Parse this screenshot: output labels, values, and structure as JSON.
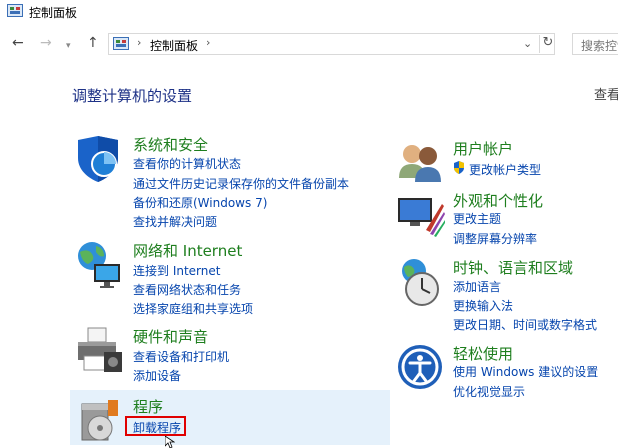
{
  "window": {
    "title": "控制面板"
  },
  "address": {
    "crumb": "控制面板",
    "search_placeholder": "搜索控制"
  },
  "main": {
    "heading": "调整计算机的设置",
    "view_by": "查看"
  },
  "categories": [
    {
      "title": "系统和安全",
      "links": [
        "查看你的计算机状态",
        "通过文件历史记录保存你的文件备份副本",
        "备份和还原(Windows 7)",
        "查找并解决问题"
      ]
    },
    {
      "title": "网络和 Internet",
      "links": [
        "连接到 Internet",
        "查看网络状态和任务",
        "选择家庭组和共享选项"
      ]
    },
    {
      "title": "硬件和声音",
      "links": [
        "查看设备和打印机",
        "添加设备"
      ]
    },
    {
      "title": "程序",
      "links": [
        "卸载程序"
      ]
    },
    {
      "title": "用户帐户",
      "links": [
        "更改帐户类型"
      ]
    },
    {
      "title": "外观和个性化",
      "links": [
        "更改主题",
        "调整屏幕分辨率"
      ]
    },
    {
      "title": "时钟、语言和区域",
      "links": [
        "添加语言",
        "更换输入法",
        "更改日期、时间或数字格式"
      ]
    },
    {
      "title": "轻松使用",
      "links": [
        "使用 Windows 建议的设置",
        "优化视觉显示"
      ]
    }
  ],
  "colors": {
    "heading": "#1e3287",
    "category_title": "#1e7e1e",
    "link": "#0645ad",
    "highlight": "#e5f1fb"
  }
}
